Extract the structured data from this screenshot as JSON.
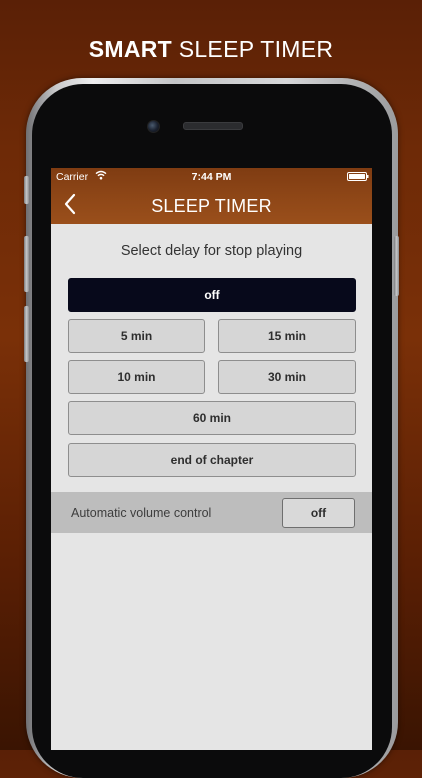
{
  "headline": {
    "bold": "SMART",
    "rest": "SLEEP TIMER"
  },
  "status_bar": {
    "carrier": "Carrier",
    "time": "7:44 PM"
  },
  "nav": {
    "title": "SLEEP TIMER",
    "back_icon": "chevron-left-icon"
  },
  "prompt": "Select delay for stop playing",
  "options": {
    "off": "off",
    "min5": "5 min",
    "min15": "15 min",
    "min10": "10 min",
    "min30": "30 min",
    "min60": "60 min",
    "end_of_chapter": "end of chapter"
  },
  "selected_option": "off",
  "auto_volume": {
    "label": "Automatic volume control",
    "value": "off"
  },
  "colors": {
    "background": "#6e2a07",
    "nav_bar": "#8f4717",
    "selected_button": "#07091b",
    "button": "#d6d6d6",
    "screen": "#e5e5e5"
  }
}
